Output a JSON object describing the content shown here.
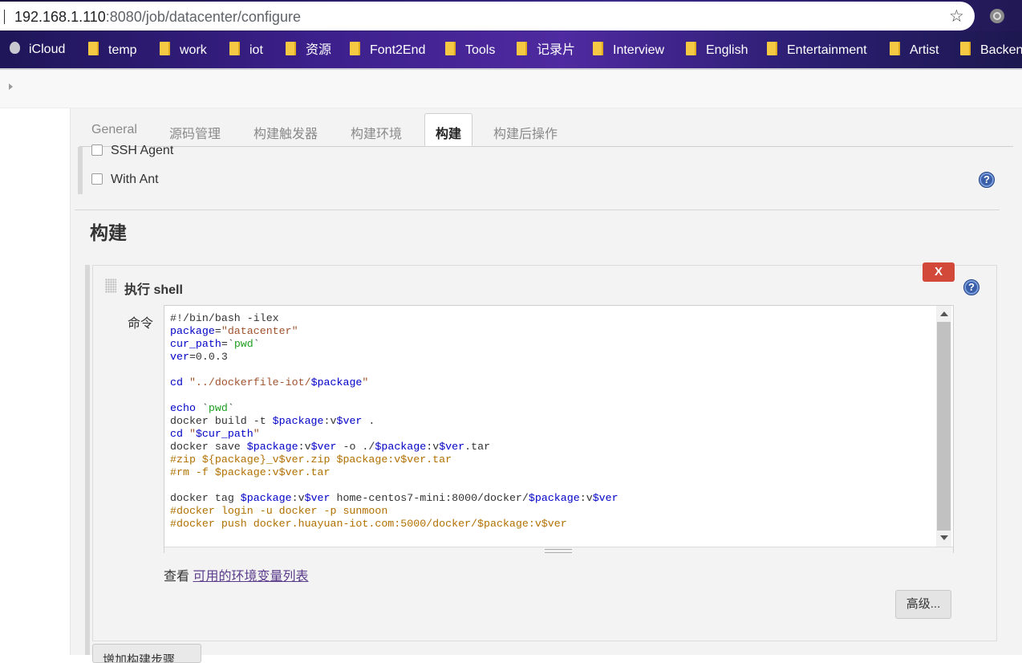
{
  "browser": {
    "url_host": "192.168.1.110",
    "url_rest": ":8080/job/datacenter/configure",
    "bookmarks": [
      "iCloud",
      "temp",
      "work",
      "iot",
      "资源",
      "Font2End",
      "Tools",
      "记录片",
      "Interview",
      "English",
      "Entertainment",
      "Artist",
      "Backen"
    ]
  },
  "tabs": [
    "General",
    "源码管理",
    "构建触发器",
    "构建环境",
    "构建",
    "构建后操作"
  ],
  "active_tab": "构建",
  "build_env": {
    "options": [
      {
        "label": "SSH Agent",
        "checked": false
      },
      {
        "label": "With Ant",
        "checked": false
      }
    ]
  },
  "section": {
    "title": "构建"
  },
  "step": {
    "title": "执行 shell",
    "delete_label": "X",
    "command_label": "命令",
    "command_lines": [
      "#!/bin/bash -ilex",
      "package=\"datacenter\"",
      "cur_path=`pwd`",
      "ver=0.0.3",
      "",
      "cd \"../dockerfile-iot/$package\"",
      "",
      "echo `pwd`",
      "docker build -t $package:v$ver .",
      "cd \"$cur_path\"",
      "docker save $package:v$ver -o ./$package:v$ver.tar",
      "#zip ${package}_v$ver.zip $package:v$ver.tar",
      "#rm -f $package:v$ver.tar",
      "",
      "docker tag $package:v$ver home-centos7-mini:8000/docker/$package:v$ver",
      "#docker login -u docker -p sunmoon",
      "#docker push docker.huayuan-iot.com:5000/docker/$package:v$ver"
    ],
    "env_prefix": "查看",
    "env_link": "可用的环境变量列表",
    "advanced_label": "高级..."
  },
  "add_step_label": "增加构建步骤",
  "colors": {
    "delete_button": "#d24939",
    "help_icon": "#3a5fa8",
    "link": "#5b3c8c"
  },
  "icons": [
    "star-icon",
    "extension-icon",
    "folder-icon",
    "help-icon",
    "drag-handle-icon"
  ]
}
